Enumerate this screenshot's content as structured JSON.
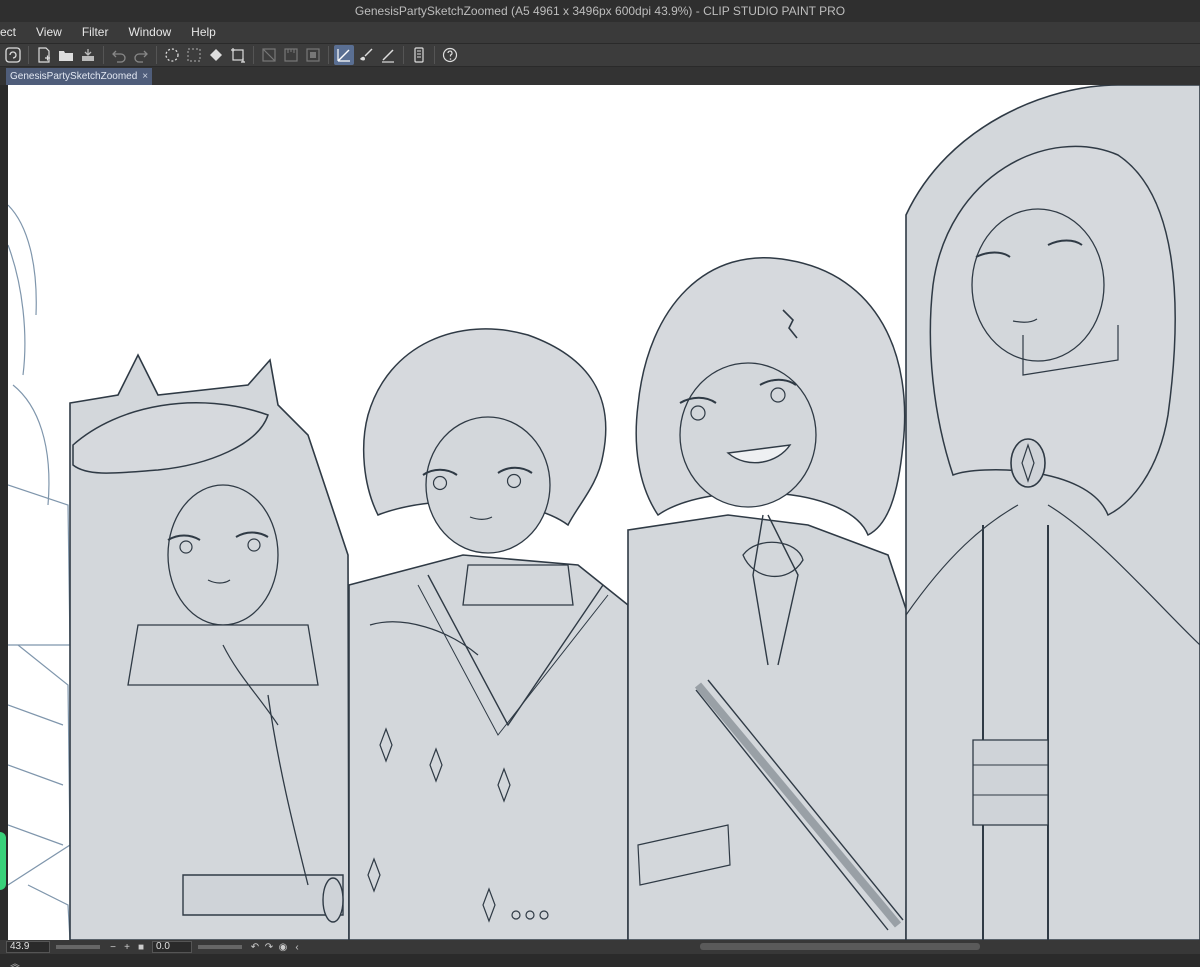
{
  "window": {
    "title": "GenesisPartySketchZoomed (A5 4961 x 3496px 600dpi 43.9%)  - CLIP STUDIO PAINT PRO"
  },
  "menu": {
    "items": [
      "ect",
      "View",
      "Filter",
      "Window",
      "Help"
    ]
  },
  "toolbar": {
    "icons": [
      "app-logo-icon",
      "new-file-icon",
      "open-file-icon",
      "save-icon",
      "undo-icon",
      "redo-icon",
      "deselect-icon",
      "selection-icon",
      "fill-icon",
      "transform-icon",
      "hide-selection-icon",
      "snap-ruler-icon",
      "snap-grid-icon",
      "snap-special-icon",
      "smart-smoothing-icon",
      "brush-icon",
      "pen-icon",
      "device-icon",
      "help-icon"
    ]
  },
  "tabs": [
    {
      "label": "GenesisPartySketchZoomed",
      "close": "×"
    }
  ],
  "status": {
    "zoom": "43.9",
    "zoom_out": "−",
    "zoom_in": "+",
    "angle": "0.0"
  },
  "colors": {
    "accent": "#5a6f93",
    "tab_active": "#4f5d7a",
    "sketch_fill": "#d3d7db",
    "line_art": "#2f3a45",
    "status_green": "#39d17a"
  }
}
